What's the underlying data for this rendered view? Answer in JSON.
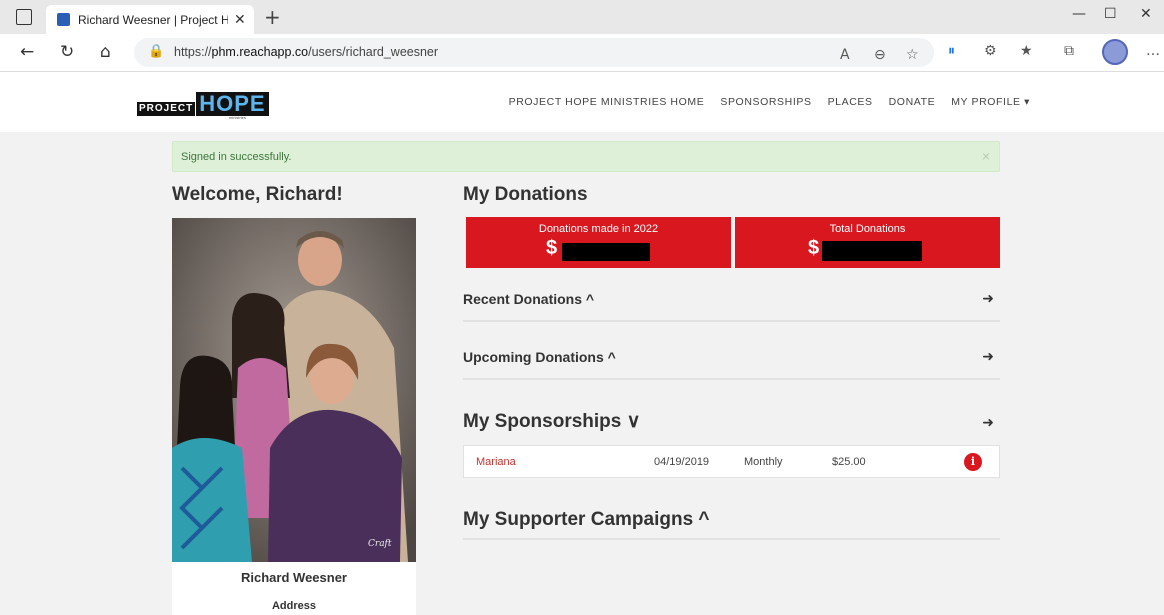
{
  "browser": {
    "tab_title": "Richard Weesner | Project Hope",
    "url_prefix": "https://",
    "url_domain": "phm.reachapp.co",
    "url_path": "/users/richard_weesner"
  },
  "site": {
    "logo_small": "PROJECT",
    "logo_big": "HOPE",
    "logo_sub": "ministries",
    "nav": [
      "PROJECT HOPE MINISTRIES HOME",
      "SPONSORSHIPS",
      "PLACES",
      "DONATE",
      "MY PROFILE ▾"
    ]
  },
  "alert": {
    "text": "Signed in successfully.",
    "close": "×"
  },
  "profile": {
    "welcome": "Welcome, Richard!",
    "name": "Richard Weesner",
    "address_label": "Address",
    "photo_signature": "Craft"
  },
  "donations": {
    "title": "My Donations",
    "stats": [
      {
        "label": "Donations made in 2022",
        "value": "$"
      },
      {
        "label": "Total Donations",
        "value": "$"
      }
    ],
    "recent": "Recent Donations ^",
    "upcoming": "Upcoming Donations ^"
  },
  "sponsorships": {
    "title": "My Sponsorships ∨",
    "rows": [
      {
        "name": "Mariana",
        "date": "04/19/2019",
        "frequency": "Monthly",
        "amount": "$25.00"
      }
    ]
  },
  "campaigns": {
    "title": "My Supporter Campaigns ^"
  },
  "colors": {
    "brand_red": "#d9171f",
    "success_bg": "#dff0d8"
  }
}
